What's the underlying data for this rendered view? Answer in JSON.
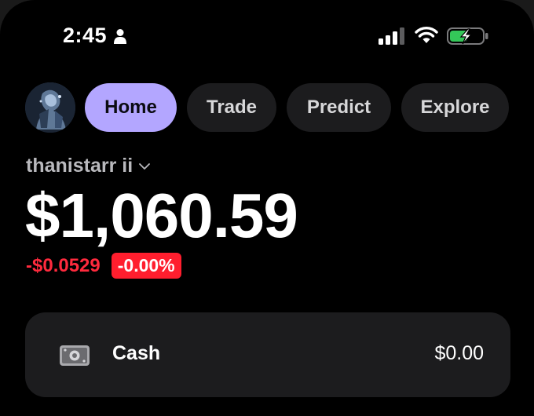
{
  "status_bar": {
    "time": "2:45",
    "icons": [
      "person-icon",
      "signal-icon",
      "wifi-icon",
      "battery-charging-icon"
    ]
  },
  "nav": {
    "avatar": "avatar",
    "tabs": [
      {
        "label": "Home",
        "active": true
      },
      {
        "label": "Trade",
        "active": false
      },
      {
        "label": "Predict",
        "active": false
      },
      {
        "label": "Explore",
        "active": false
      }
    ]
  },
  "account": {
    "name": "thanistarr ii",
    "balance": "$1,060.59",
    "change_amount": "-$0.0529",
    "change_percent": "-0.00%"
  },
  "cash_card": {
    "icon": "cash-icon",
    "label": "Cash",
    "value": "$0.00"
  },
  "colors": {
    "accent": "#b3a6ff",
    "negative": "#ff2a3d",
    "card": "#1c1c1e",
    "background": "#000000"
  }
}
